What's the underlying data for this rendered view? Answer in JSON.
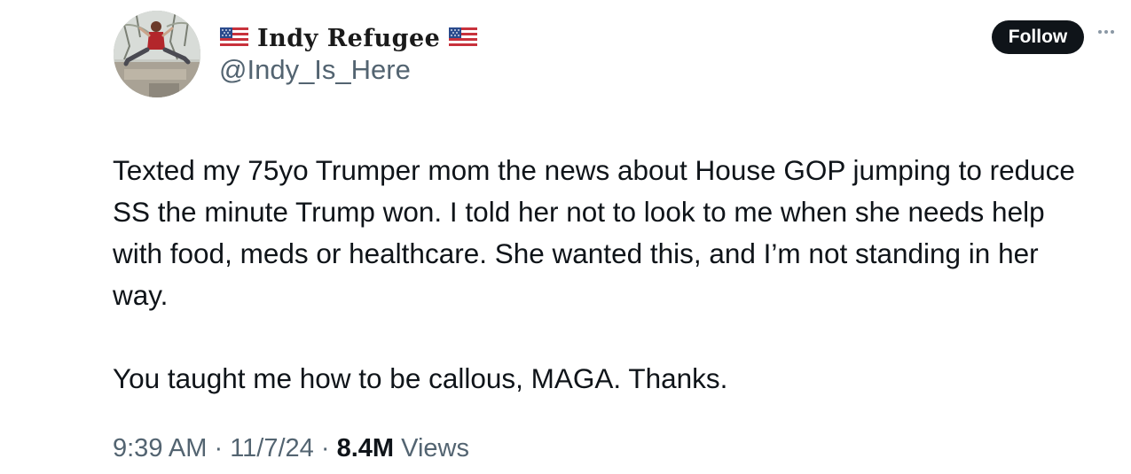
{
  "author": {
    "display_name": "Indy Refugee",
    "handle": "@Indy_Is_Here",
    "name_decoration_icon": "us-flag-icon"
  },
  "actions": {
    "follow_label": "Follow",
    "more_icon": "more-dots-icon"
  },
  "tweet": {
    "paragraphs": [
      "Texted my 75yo Trumper mom the news about House GOP jumping to reduce SS the minute Trump won. I told her not to look to me when she needs help with food, meds or healthcare. She wanted this, and I’m not standing in her way.",
      "You taught me how to be callous, MAGA. Thanks."
    ]
  },
  "meta": {
    "time": "9:39 AM",
    "separator": "·",
    "date": "11/7/24",
    "views_count": "8.4M",
    "views_label": "Views"
  },
  "colors": {
    "text": "#0f1419",
    "secondary_text": "#536471",
    "follow_bg": "#0f1419",
    "follow_text": "#ffffff"
  }
}
